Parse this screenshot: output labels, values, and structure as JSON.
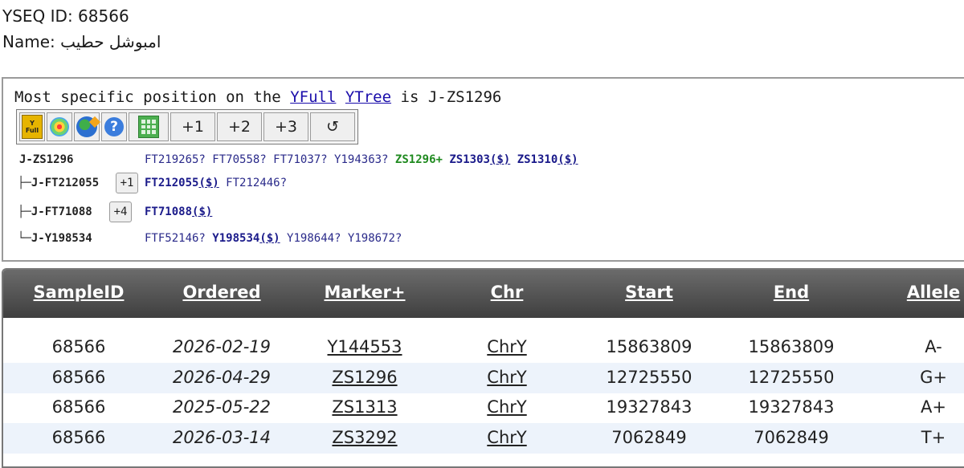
{
  "header": {
    "yseq_label": "YSEQ ID:",
    "yseq_id": "68566",
    "name_label": "Name:",
    "name_value": "امبوشل حطيب"
  },
  "tree": {
    "title_prefix": "Most specific position on the",
    "link_yfull": "YFull",
    "link_ytree": "YTree",
    "title_suffix": "is J-ZS1296",
    "toolbar": {
      "yfull_icon_text": "Full",
      "expand_1": "+1",
      "expand_2": "+2",
      "expand_3": "+3",
      "reset": "↺"
    },
    "nodes": [
      {
        "prefix": "",
        "name": "J-ZS1296",
        "button": "",
        "snps": [
          {
            "text": "FT219265?",
            "style": "q"
          },
          {
            "text": "FT70558?",
            "style": "q"
          },
          {
            "text": "FT71037?",
            "style": "q"
          },
          {
            "text": "Y194363?",
            "style": "q"
          },
          {
            "text": "ZS1296+",
            "style": "g"
          },
          {
            "text": "ZS1303",
            "style": "b",
            "dollar": "($)"
          },
          {
            "text": "ZS1310",
            "style": "b",
            "dollar": "($)"
          }
        ]
      },
      {
        "prefix": "├",
        "name": "J-FT212055",
        "button": "+1",
        "snps": [
          {
            "text": "FT212055",
            "style": "b",
            "dollar": "($)"
          },
          {
            "text": "FT212446?",
            "style": "q"
          }
        ]
      },
      {
        "prefix": "├",
        "name": "J-FT71088",
        "button": "+4",
        "snps": [
          {
            "text": "FT71088",
            "style": "b",
            "dollar": "($)"
          }
        ]
      },
      {
        "prefix": "└",
        "name": "J-Y198534",
        "button": "",
        "snps": [
          {
            "text": "FTF52146?",
            "style": "q"
          },
          {
            "text": "Y198534",
            "style": "b",
            "dollar": "($)"
          },
          {
            "text": "Y198644?",
            "style": "q"
          },
          {
            "text": "Y198672?",
            "style": "q"
          }
        ]
      }
    ]
  },
  "table": {
    "columns": [
      "SampleID",
      "Ordered",
      "Marker+",
      "Chr",
      "Start",
      "End",
      "Allele"
    ],
    "rows": [
      [
        "68566",
        "2026-02-19",
        "Y144553",
        "ChrY",
        "15863809",
        "15863809",
        "A-"
      ],
      [
        "68566",
        "2026-04-29",
        "ZS1296",
        "ChrY",
        "12725550",
        "12725550",
        "G+"
      ],
      [
        "68566",
        "2025-05-22",
        "ZS1313",
        "ChrY",
        "19327843",
        "19327843",
        "A+"
      ],
      [
        "68566",
        "2026-03-14",
        "ZS3292",
        "ChrY",
        "7062849",
        "7062849",
        "T+"
      ]
    ]
  }
}
